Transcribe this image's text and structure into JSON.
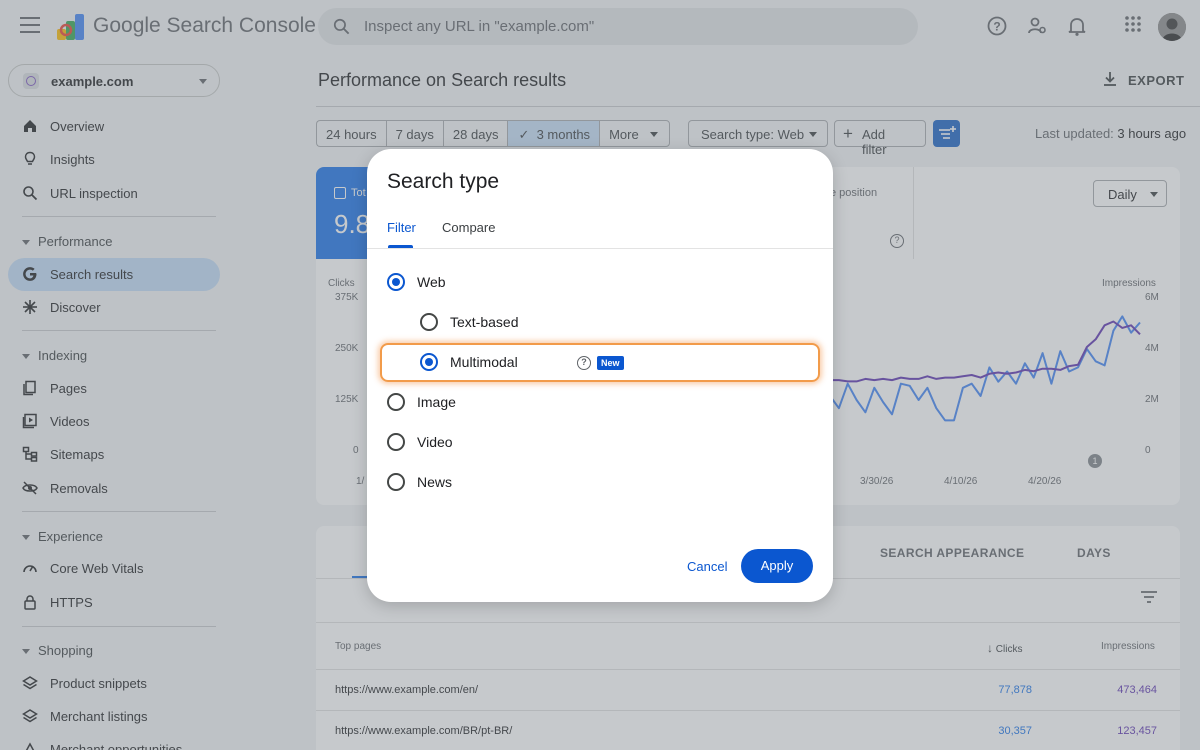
{
  "app": {
    "title": "Google Search Console"
  },
  "search": {
    "placeholder": "Inspect any URL in \"example.com\""
  },
  "property": {
    "name": "example.com"
  },
  "sidebar": {
    "overview": "Overview",
    "insights": "Insights",
    "url_inspection": "URL inspection",
    "performance": {
      "label": "Performance",
      "items": [
        "Search results",
        "Discover"
      ]
    },
    "indexing": {
      "label": "Indexing",
      "items": [
        "Pages",
        "Videos",
        "Sitemaps",
        "Removals"
      ]
    },
    "experience": {
      "label": "Experience",
      "items": [
        "Core Web Vitals",
        "HTTPS"
      ]
    },
    "shopping": {
      "label": "Shopping",
      "items": [
        "Product snippets",
        "Merchant listings",
        "Merchant opportunities"
      ]
    }
  },
  "main": {
    "title": "Performance on Search results",
    "export_label": "EXPORT",
    "date_ranges": [
      "24 hours",
      "7 days",
      "28 days",
      "3 months",
      "More"
    ],
    "selected_range": "3 months",
    "search_type_chip": "Search type: Web",
    "add_filter": "Add filter",
    "last_updated_label": "Last updated:",
    "last_updated_value": "3 hours ago"
  },
  "chart": {
    "metric_title": "Tot",
    "metric_value": "9.8",
    "position_label": "e position",
    "granularity": "Daily",
    "left_axis_title": "Clicks",
    "left_ticks": [
      "375K",
      "250K",
      "125K",
      "0"
    ],
    "right_axis_title": "Impressions",
    "right_ticks": [
      "6M",
      "4M",
      "2M",
      "0"
    ],
    "x_ticks": [
      "1/",
      "3/30/26",
      "4/10/26",
      "4/20/26"
    ],
    "annotation": "1"
  },
  "chart_data": {
    "type": "line",
    "x": [
      "3/26/26",
      "3/27/26",
      "3/28/26",
      "3/29/26",
      "3/30/26",
      "3/31/26",
      "4/1/26",
      "4/2/26",
      "4/3/26",
      "4/4/26",
      "4/5/26",
      "4/6/26",
      "4/7/26",
      "4/8/26",
      "4/9/26",
      "4/10/26",
      "4/11/26",
      "4/12/26",
      "4/13/26",
      "4/14/26",
      "4/15/26",
      "4/16/26",
      "4/17/26",
      "4/18/26",
      "4/19/26",
      "4/20/26",
      "4/21/26",
      "4/22/26",
      "4/23/26",
      "4/24/26",
      "4/25/26",
      "4/26/26",
      "4/27/26",
      "4/28/26",
      "4/29/26",
      "4/30/26"
    ],
    "series": [
      {
        "name": "Clicks",
        "axis": "left",
        "color": "#4285f4",
        "values": [
          130000,
          100000,
          160000,
          120000,
          90000,
          150000,
          115000,
          85000,
          160000,
          155000,
          120000,
          150000,
          100000,
          70000,
          70000,
          150000,
          160000,
          130000,
          200000,
          165000,
          190000,
          160000,
          210000,
          175000,
          235000,
          160000,
          240000,
          190000,
          200000,
          245000,
          215000,
          205000,
          290000,
          325000,
          285000,
          310000
        ]
      },
      {
        "name": "Impressions",
        "axis": "right",
        "color": "#5e35b1",
        "values": [
          2700000,
          2700000,
          2650000,
          2650000,
          2750000,
          2700000,
          2750000,
          2700000,
          2800000,
          2750000,
          2750000,
          2850000,
          2750000,
          2800000,
          2800000,
          2850000,
          2900000,
          2800000,
          2950000,
          3000000,
          2950000,
          3000000,
          3100000,
          3050000,
          3150000,
          3150000,
          3100000,
          3250000,
          3300000,
          4000000,
          4300000,
          4850000,
          5000000,
          4750000,
          4850000,
          4500000
        ]
      }
    ],
    "left_ylim": [
      0,
      375000
    ],
    "right_ylim": [
      0,
      6000000
    ]
  },
  "table": {
    "tabs": [
      "SEARCH APPEARANCE",
      "DAYS"
    ],
    "columns": {
      "page": "Top pages",
      "clicks": "Clicks",
      "impressions": "Impressions"
    },
    "rows": [
      {
        "url": "https://www.example.com/en/",
        "clicks": "77,878",
        "impressions": "473,464"
      },
      {
        "url": "https://www.example.com/BR/pt-BR/",
        "clicks": "30,357",
        "impressions": "123,457"
      }
    ]
  },
  "dialog": {
    "title": "Search type",
    "tabs": [
      "Filter",
      "Compare"
    ],
    "options": {
      "web": "Web",
      "text_based": "Text-based",
      "multimodal": "Multimodal",
      "image": "Image",
      "video": "Video",
      "news": "News"
    },
    "new_badge": "New",
    "cancel": "Cancel",
    "apply": "Apply"
  },
  "colors": {
    "accent": "#0b57d0",
    "clicks": "#4285f4",
    "impressions": "#5e35b1",
    "highlight": "#f29b4a"
  }
}
